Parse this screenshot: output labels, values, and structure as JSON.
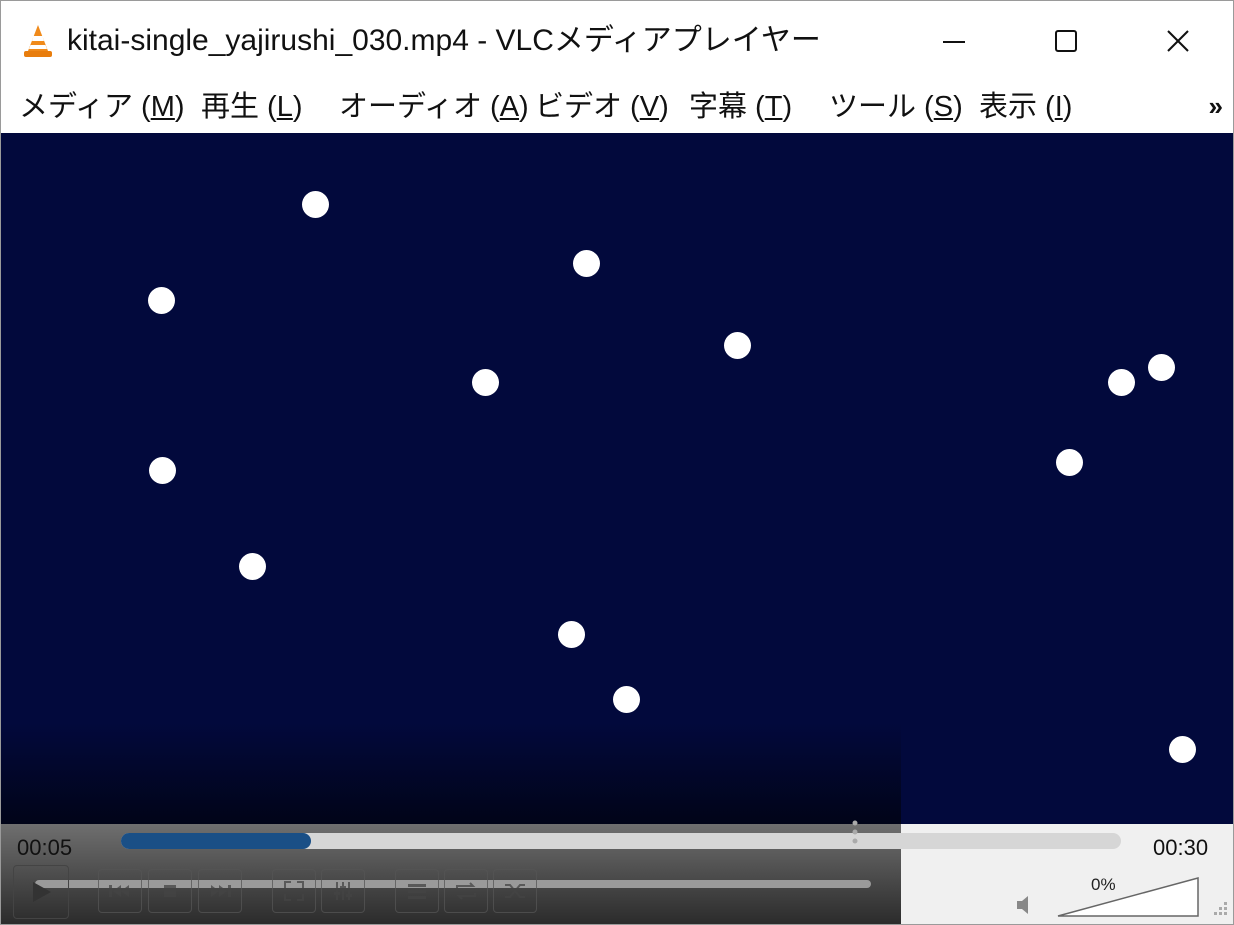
{
  "window": {
    "title": "kitai-single_yajirushi_030.mp4 - VLCメディアプレイヤー",
    "buttons": [
      "minimize",
      "maximize",
      "close"
    ]
  },
  "menubar": {
    "items": [
      {
        "label": "メディア (",
        "accel": "M",
        "suffix": ")"
      },
      {
        "label": "再生 (",
        "accel": "L",
        "suffix": ")"
      },
      {
        "label": "オーディオ (",
        "accel": "A",
        "suffix": ")"
      },
      {
        "label": "ビデオ (",
        "accel": "V",
        "suffix": ")"
      },
      {
        "label": "字幕 (",
        "accel": "T",
        "suffix": ")"
      },
      {
        "label": "ツール (",
        "accel": "S",
        "suffix": ")"
      },
      {
        "label": "表示 (",
        "accel": "I",
        "suffix": ")"
      }
    ],
    "more": "»"
  },
  "video": {
    "background": "#02093c",
    "dot_color": "#ffffff",
    "dot_count": 16
  },
  "playback": {
    "current_time": "00:05",
    "total_time": "00:30",
    "progress": 0.19,
    "accent": "#1a4f86"
  },
  "volume": {
    "label": "0%"
  },
  "icons": {
    "app": "vlc-cone-icon",
    "play": "play-icon",
    "prev": "skip-back-icon",
    "stop": "stop-icon",
    "next": "skip-forward-icon",
    "fullscreen": "fullscreen-icon",
    "extended": "equalizer-icon",
    "playlist": "playlist-icon",
    "loop": "loop-icon",
    "shuffle": "shuffle-icon",
    "speaker": "speaker-icon"
  }
}
